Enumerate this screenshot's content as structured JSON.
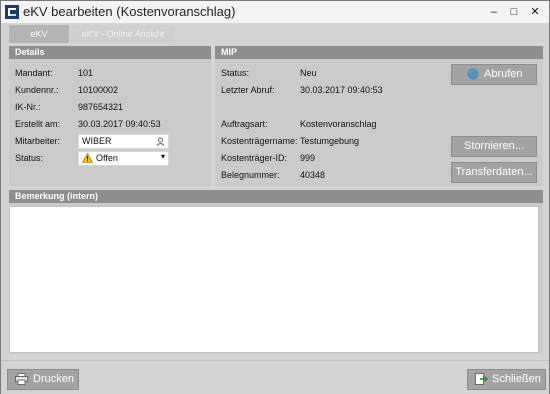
{
  "window": {
    "title": "eKV bearbeiten (Kostenvoranschlag)",
    "minimize": "‒",
    "maximize": "□",
    "close": "✕"
  },
  "tabs": [
    {
      "label": "eKV",
      "active": true
    },
    {
      "label": "eKV - Online Ansicht",
      "active": false
    }
  ],
  "details": {
    "header": "Details",
    "mandant_label": "Mandant:",
    "mandant": "101",
    "kundennr_label": "Kundennr.:",
    "kundennr": "10100002",
    "ik_label": "IK-Nr.:",
    "ik": "987654321",
    "erstellt_label": "Erstellt am:",
    "erstellt": "30.03.2017 09:40:53",
    "mitarbeiter_label": "Mitarbeiter:",
    "mitarbeiter": "WIBER",
    "status_label": "Status:",
    "status": "Offen"
  },
  "mip": {
    "header": "MIP",
    "status_label": "Status:",
    "status": "Neu",
    "abruf_label": "Letzter Abruf:",
    "abruf": "30.03.2017 09:40:53",
    "auftrag_label": "Auftragsart:",
    "auftrag": "Kostenvoranschlag",
    "ktname_label": "Kostenträgername:",
    "ktname": "Testumgebung",
    "ktid_label": "Kostenträger-ID:",
    "ktid": "999",
    "beleg_label": "Belegnummer:",
    "beleg": "40348",
    "abrufen_button": "Abrufen",
    "stornieren_button": "Stornieren...",
    "transfer_button": "Transferdaten..."
  },
  "bemerkung": {
    "header": "Bemerkung (intern)",
    "value": ""
  },
  "footer": {
    "drucken_button": "Drucken",
    "schliessen_button": "Schließen"
  },
  "colors": {
    "panel_header": "#8e8e8e",
    "button": "#a3a3a3",
    "warning": "#f2c200"
  }
}
